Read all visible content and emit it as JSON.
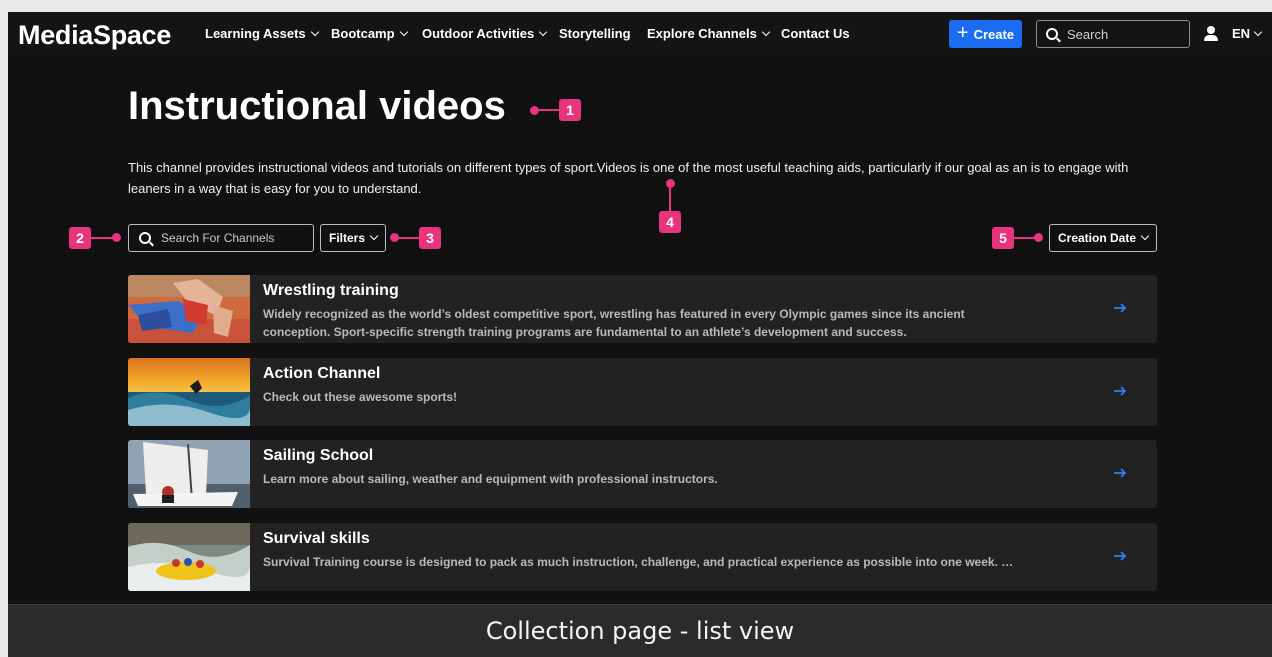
{
  "app": {
    "logo": "MediaSpace"
  },
  "nav": {
    "items": [
      {
        "label": "Learning Assets",
        "dropdown": true
      },
      {
        "label": "Bootcamp",
        "dropdown": true
      },
      {
        "label": "Outdoor Activities",
        "dropdown": true
      },
      {
        "label": "Storytelling",
        "dropdown": false
      },
      {
        "label": "Explore Channels",
        "dropdown": true
      },
      {
        "label": "Contact Us",
        "dropdown": false
      }
    ],
    "create_label": "Create",
    "search_placeholder": "Search",
    "language": "EN"
  },
  "page": {
    "title": "Instructional videos",
    "description": "This channel provides instructional videos and tutorials on different types of sport.Videos is one of the most useful teaching aids, particularly if our goal as an is to engage with leaners in a way that is easy for you to understand."
  },
  "controls": {
    "search_placeholder": "Search For Channels",
    "filters_label": "Filters",
    "sort_label": "Creation Date"
  },
  "annotations": [
    "1",
    "2",
    "3",
    "4",
    "5"
  ],
  "channels": [
    {
      "title": "Wrestling training",
      "description": "Widely recognized as the world’s oldest competitive sport, wrestling has featured in every Olympic games since its ancient conception. Sport-specific strength training programs are fundamental to an athlete’s development and success."
    },
    {
      "title": "Action Channel",
      "description": "Check out these awesome sports!"
    },
    {
      "title": "Sailing School",
      "description": "Learn more about sailing, weather and equipment with professional instructors."
    },
    {
      "title": "Survival skills",
      "description": "Survival Training course is designed to pack as much instruction, challenge, and practical experience as possible into one week. …"
    }
  ],
  "caption": "Collection page - list view",
  "colors": {
    "accent": "#1b6cf0",
    "annotation": "#e8337d",
    "background": "#111111",
    "card": "#222222"
  }
}
